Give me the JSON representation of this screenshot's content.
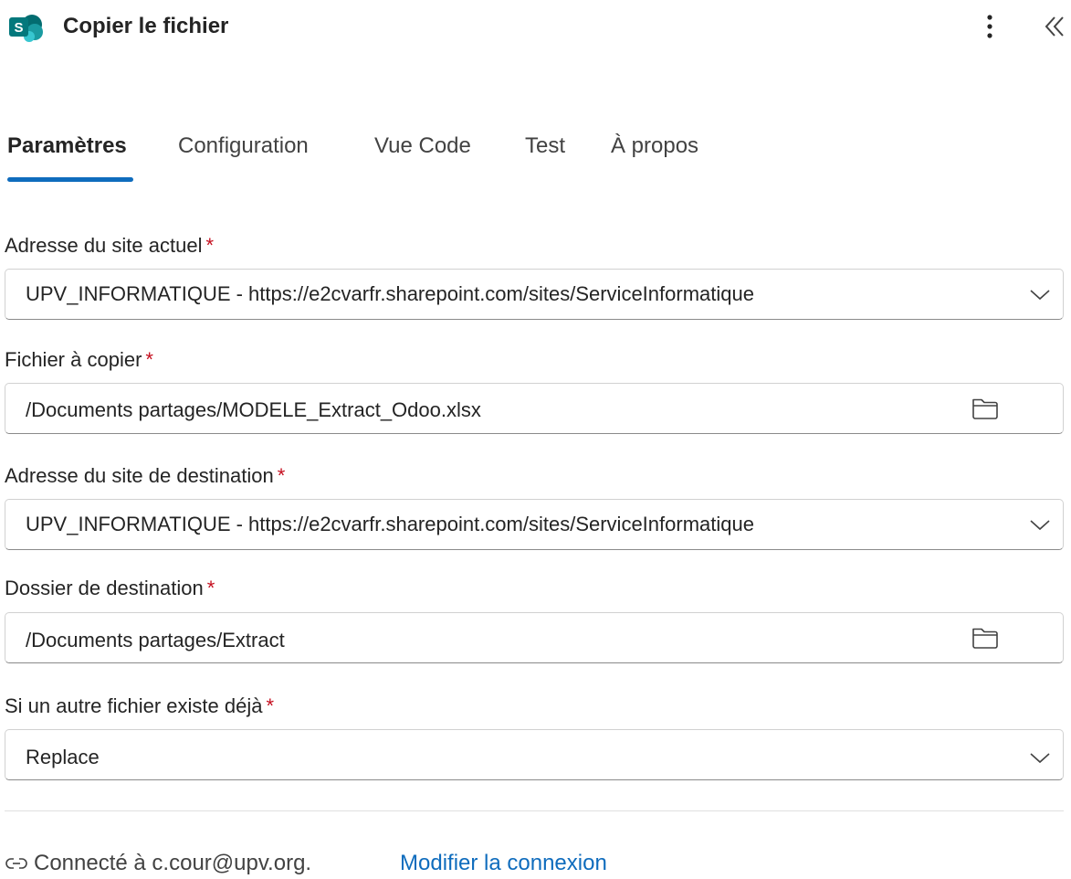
{
  "header": {
    "app_icon": "sharepoint-icon",
    "title": "Copier le fichier",
    "more_icon": "more-vertical-icon",
    "collapse_icon": "chevron-double-left-icon"
  },
  "tabs": [
    {
      "label": "Paramètres",
      "active": true
    },
    {
      "label": "Configuration",
      "active": false
    },
    {
      "label": "Vue Code",
      "active": false
    },
    {
      "label": "Test",
      "active": false
    },
    {
      "label": "À propos",
      "active": false
    }
  ],
  "form": {
    "required_marker": "*",
    "current_site": {
      "label": "Adresse du site actuel",
      "value": "UPV_INFORMATIQUE - https://e2cvarfr.sharepoint.com/sites/ServiceInformatique",
      "icon": "chevron-down-icon"
    },
    "file_to_copy": {
      "label": "Fichier à copier",
      "value": "/Documents partages/MODELE_Extract_Odoo.xlsx",
      "icon": "folder-icon"
    },
    "destination_site": {
      "label": "Adresse du site de destination",
      "value": "UPV_INFORMATIQUE - https://e2cvarfr.sharepoint.com/sites/ServiceInformatique",
      "icon": "chevron-down-icon"
    },
    "destination_folder": {
      "label": "Dossier de destination",
      "value": "/Documents partages/Extract",
      "icon": "folder-icon"
    },
    "if_exists": {
      "label": "Si un autre fichier existe déjà",
      "value": "Replace",
      "icon": "chevron-down-icon"
    }
  },
  "connection": {
    "icon": "link-icon",
    "text": "Connecté à c.cour@upv.org.",
    "modify_label": "Modifier la connexion"
  },
  "colors": {
    "accent": "#0f6cbd",
    "required": "#c50f1f",
    "sharepoint_teal": "#038387"
  }
}
